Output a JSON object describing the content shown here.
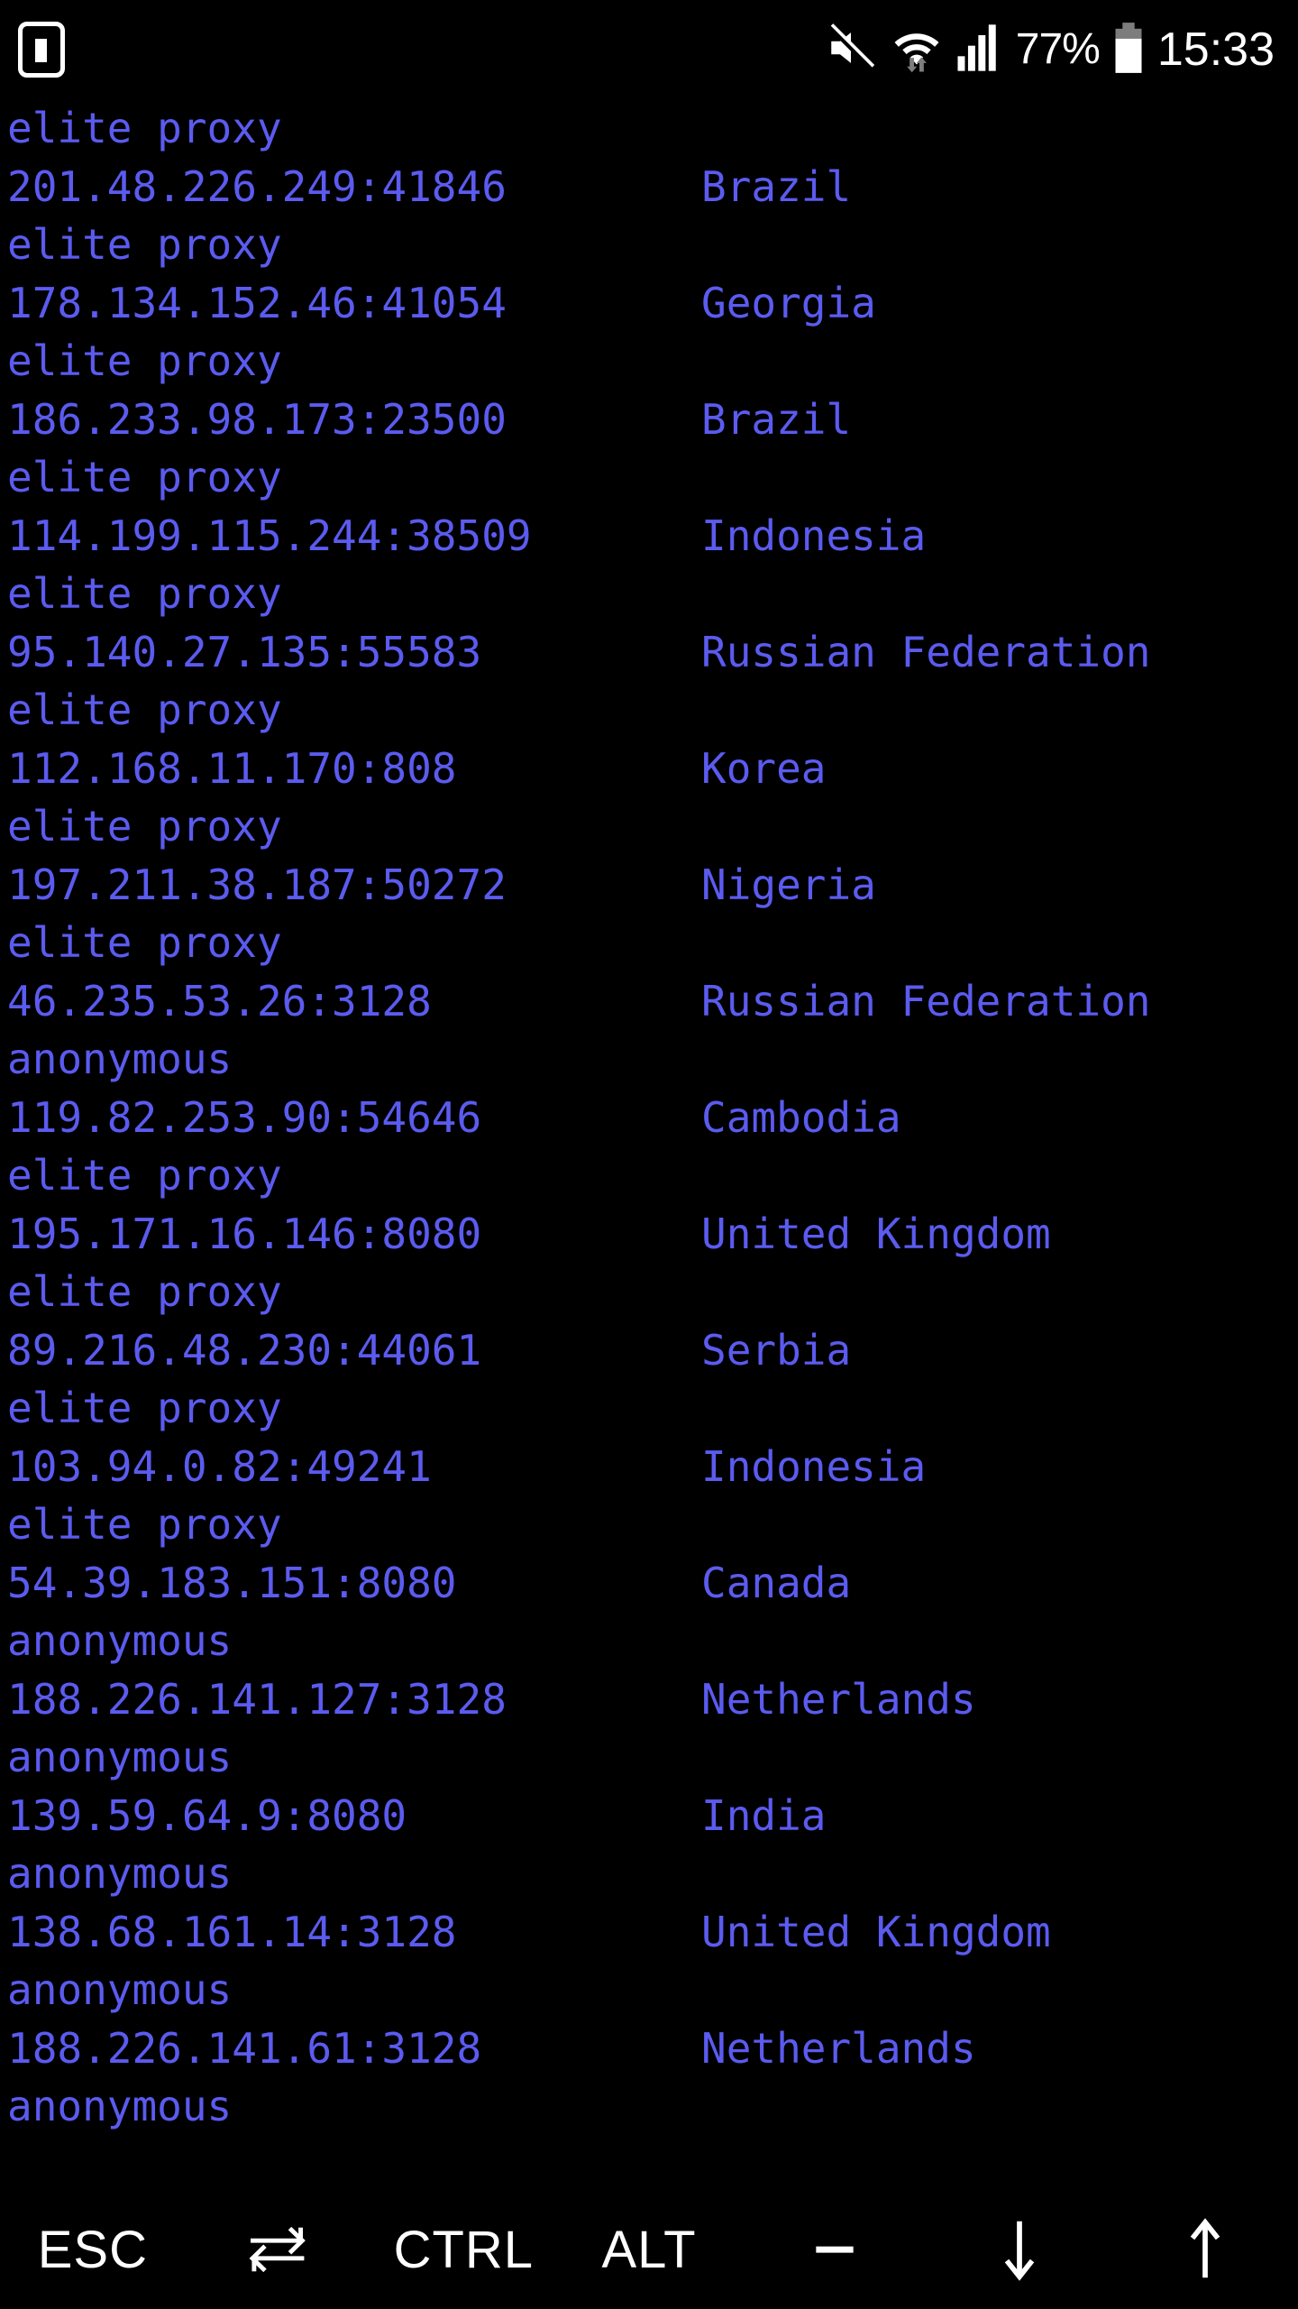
{
  "status_bar": {
    "left_icons": [
      {
        "name": "terminal-notification-icon",
        "glyph": "terminal"
      }
    ],
    "right_icons": [
      {
        "name": "mute-icon",
        "glyph": "speaker-muted"
      },
      {
        "name": "wifi-icon",
        "glyph": "wifi-with-data-arrows"
      },
      {
        "name": "cellular-signal-icon",
        "glyph": "signal-bars"
      }
    ],
    "battery_percent": "77%",
    "battery_icon": "battery-icon",
    "clock": "15:33",
    "colors": {
      "foreground": "#ffffff",
      "background": "#000000"
    }
  },
  "terminal": {
    "colors": {
      "text": "#5b5bf0",
      "background": "#000000"
    },
    "lines": [
      {
        "type": "anonymity",
        "text": "elite proxy"
      },
      {
        "type": "entry",
        "address": "201.48.226.249:41846",
        "country": "Brazil"
      },
      {
        "type": "anonymity",
        "text": "elite proxy"
      },
      {
        "type": "entry",
        "address": "178.134.152.46:41054",
        "country": "Georgia"
      },
      {
        "type": "anonymity",
        "text": "elite proxy"
      },
      {
        "type": "entry",
        "address": "186.233.98.173:23500",
        "country": "Brazil"
      },
      {
        "type": "anonymity",
        "text": "elite proxy"
      },
      {
        "type": "entry",
        "address": "114.199.115.244:38509",
        "country": "Indonesia"
      },
      {
        "type": "anonymity",
        "text": "elite proxy"
      },
      {
        "type": "entry",
        "address": "95.140.27.135:55583",
        "country": "Russian Federation"
      },
      {
        "type": "anonymity",
        "text": "elite proxy"
      },
      {
        "type": "entry",
        "address": "112.168.11.170:808",
        "country": "Korea"
      },
      {
        "type": "anonymity",
        "text": "elite proxy"
      },
      {
        "type": "entry",
        "address": "197.211.38.187:50272",
        "country": "Nigeria"
      },
      {
        "type": "anonymity",
        "text": "elite proxy"
      },
      {
        "type": "entry",
        "address": "46.235.53.26:3128",
        "country": "Russian Federation"
      },
      {
        "type": "anonymity",
        "text": "anonymous"
      },
      {
        "type": "entry",
        "address": "119.82.253.90:54646",
        "country": "Cambodia"
      },
      {
        "type": "anonymity",
        "text": "elite proxy"
      },
      {
        "type": "entry",
        "address": "195.171.16.146:8080",
        "country": "United Kingdom"
      },
      {
        "type": "anonymity",
        "text": "elite proxy"
      },
      {
        "type": "entry",
        "address": "89.216.48.230:44061",
        "country": "Serbia"
      },
      {
        "type": "anonymity",
        "text": "elite proxy"
      },
      {
        "type": "entry",
        "address": "103.94.0.82:49241",
        "country": "Indonesia"
      },
      {
        "type": "anonymity",
        "text": "elite proxy"
      },
      {
        "type": "entry",
        "address": "54.39.183.151:8080",
        "country": "Canada"
      },
      {
        "type": "anonymity",
        "text": "anonymous"
      },
      {
        "type": "entry",
        "address": "188.226.141.127:3128",
        "country": "Netherlands"
      },
      {
        "type": "anonymity",
        "text": "anonymous"
      },
      {
        "type": "entry",
        "address": "139.59.64.9:8080",
        "country": "India"
      },
      {
        "type": "anonymity",
        "text": "anonymous"
      },
      {
        "type": "entry",
        "address": "138.68.161.14:3128",
        "country": "United Kingdom"
      },
      {
        "type": "anonymity",
        "text": "anonymous"
      },
      {
        "type": "entry",
        "address": "188.226.141.61:3128",
        "country": "Netherlands"
      },
      {
        "type": "anonymity",
        "text": "anonymous"
      }
    ]
  },
  "keybar": {
    "keys": [
      {
        "name": "key-esc",
        "label": "ESC",
        "kind": "text"
      },
      {
        "name": "key-tab",
        "label": "⇄",
        "kind": "icon",
        "icon": "tab-swap-icon"
      },
      {
        "name": "key-ctrl",
        "label": "CTRL",
        "kind": "text"
      },
      {
        "name": "key-alt",
        "label": "ALT",
        "kind": "text"
      },
      {
        "name": "key-minus",
        "label": "—",
        "kind": "icon",
        "icon": "minus-icon"
      },
      {
        "name": "key-arrow-down",
        "label": "↓",
        "kind": "icon",
        "icon": "arrow-down-icon"
      },
      {
        "name": "key-arrow-up",
        "label": "↑",
        "kind": "icon",
        "icon": "arrow-up-icon"
      }
    ]
  }
}
